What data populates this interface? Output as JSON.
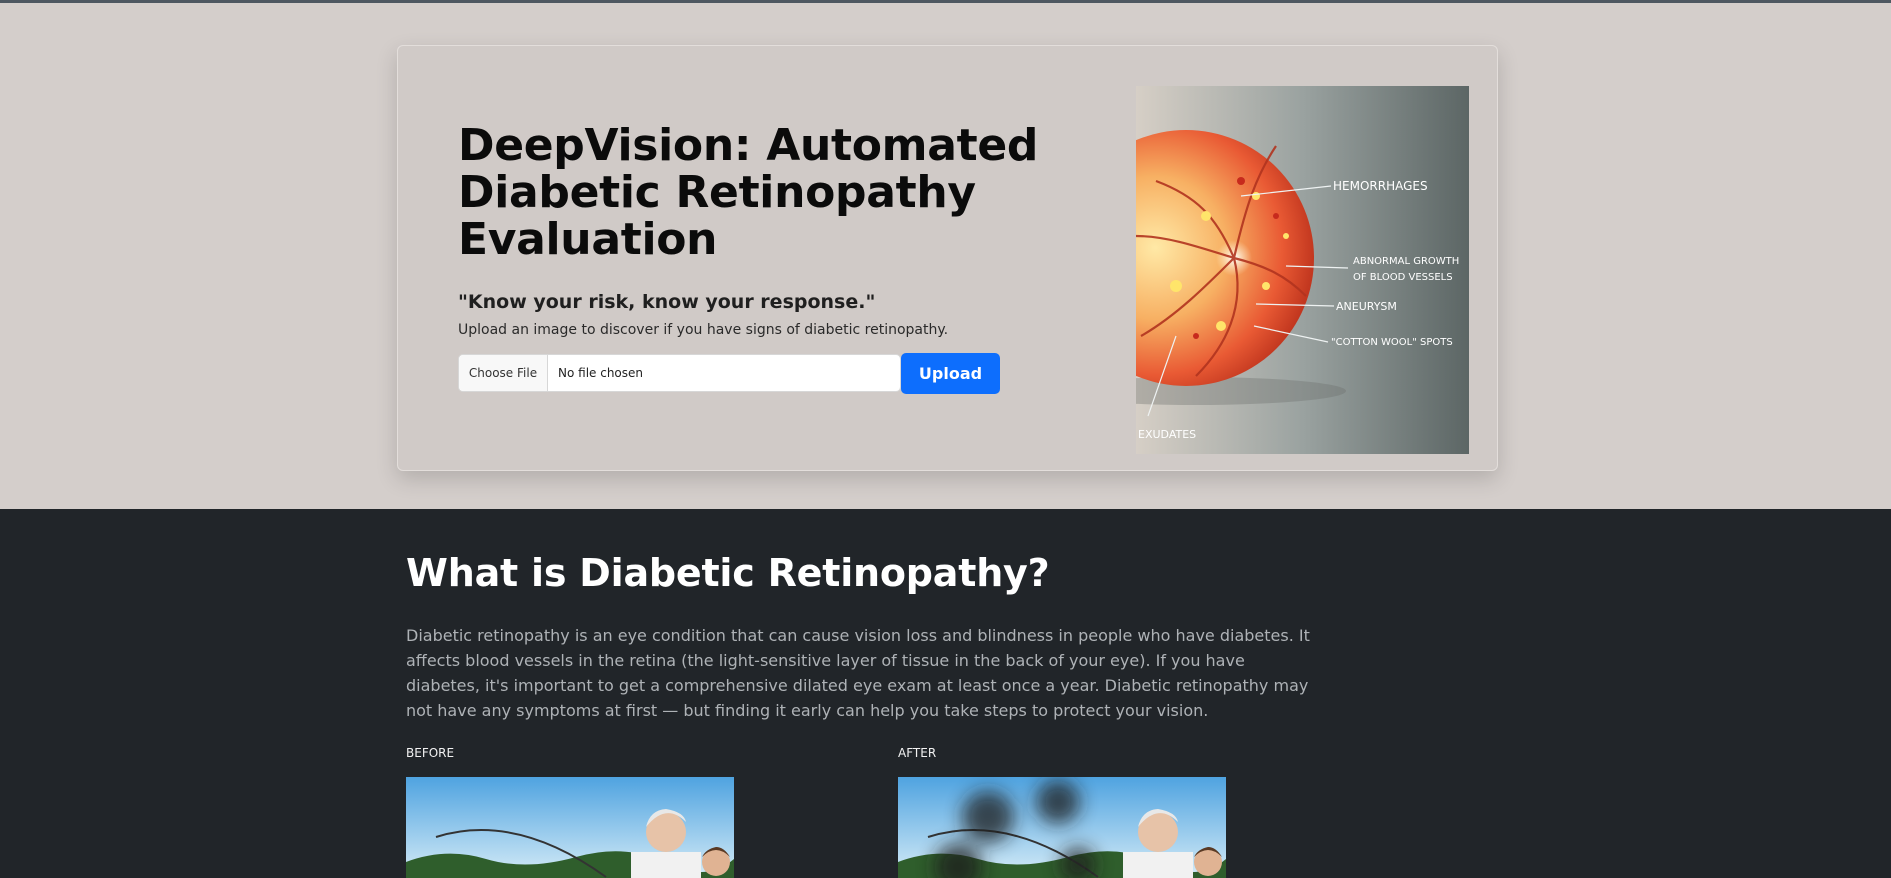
{
  "hero": {
    "title": "DeepVision: Automated Diabetic Retinopathy Evaluation",
    "tagline": "\"Know your risk, know your response.\"",
    "description": "Upload an image to discover if you have signs of diabetic retinopathy.",
    "file_input": {
      "button_label": "Choose File",
      "status": "No file chosen"
    },
    "upload_label": "Upload",
    "upload_color": "#0d6efd",
    "image": {
      "labels": {
        "hemorrhages": "HEMORRHAGES",
        "abnormal_1": "ABNORMAL GROWTH",
        "abnormal_2": "OF BLOOD VESSELS",
        "aneurysm": "ANEURYSM",
        "cotton": "\"COTTON WOOL\" SPOTS",
        "exudates": "EXUDATES"
      }
    }
  },
  "info": {
    "title": "What is Diabetic Retinopathy?",
    "text": "Diabetic retinopathy is an eye condition that can cause vision loss and blindness in people who have diabetes. It affects blood vessels in the retina (the light-sensitive layer of tissue in the back of your eye). If you have diabetes, it's important to get a comprehensive dilated eye exam at least once a year. Diabetic retinopathy may not have any symptoms at first — but finding it early can help you take steps to protect your vision.",
    "before_label": "BEFORE",
    "after_label": "AFTER"
  }
}
